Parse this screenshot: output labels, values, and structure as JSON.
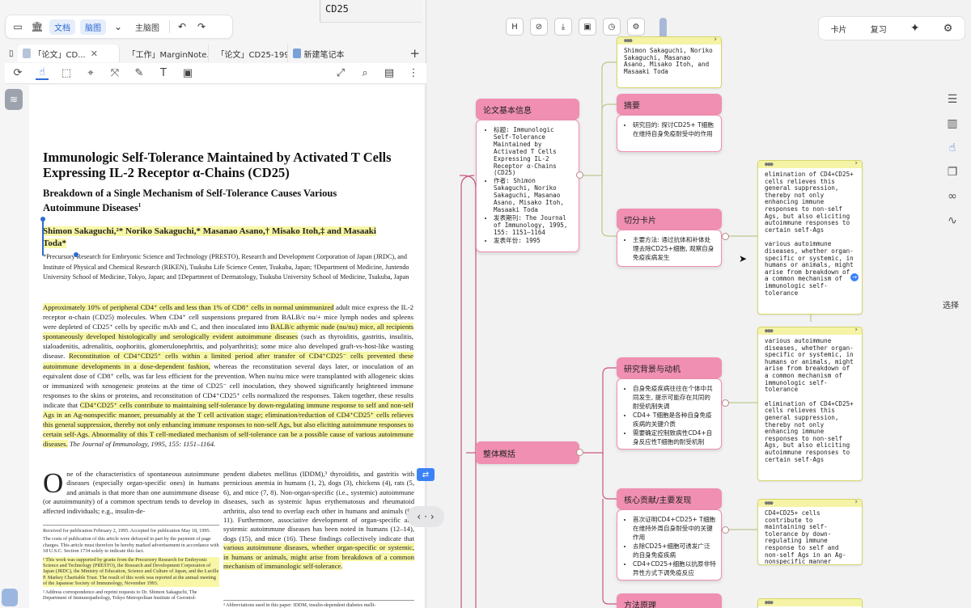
{
  "toolbar": {
    "doc_label": "文档",
    "map_label": "脑图",
    "mainmap_label": "主脑图"
  },
  "tabs": [
    {
      "label": "「论文」CD..."
    },
    {
      "label": "「工作」MarginNote..."
    },
    {
      "label": "「论文」CD25-1995..."
    },
    {
      "label": "新建笔记本"
    }
  ],
  "snippet": {
    "text": "CD25"
  },
  "paper": {
    "title": "Immunologic Self-Tolerance Maintained by Activated T Cells Expressing IL-2 Receptor α-Chains (CD25)",
    "subtitle": "Breakdown of a Single Mechanism of Self-Tolerance Causes Various Autoimmune Diseases",
    "authors": "Shimon Sakaguchi,²* Noriko Sakaguchi,* Masanao Asano,† Misako Itoh,‡ and Masaaki Toda*",
    "affil": "*Precursory Research for Embryonic Science and Technology (PRESTO), Research and Development Corporation of Japan (JRDC), and Institute of Physical and Chemical Research (RIKEN), Tsukuba Life Science Center, Tsukuba, Japan; †Department of Medicine, Juntendo University School of Medicine, Tokyo, Japan; and ‡Department of Dermatology, Tsukuba University School of Medicine, Tsukuba, Japan",
    "abstract_1": "Approximately 10% of peripheral CD4⁺ cells and less than 1% of CD8⁺ cells in normal unimmunized",
    "abstract_2": " adult mice express the IL-2 receptor α-chain (CD25) molecules. When CD4⁺ cell suspensions prepared from BALB/c nu/+ mice lymph nodes and spleens were depleted of CD25⁺ cells by specific mAb and C, and then inoculated into ",
    "abstract_3": "BALB/c athymic nude (nu/nu) mice, all recipients spontaneously developed histologically and serologically evident autoimmune diseases",
    "abstract_4": " (such as thyroiditis, gastritis, insulitis, sialoadenitis, adrenalitis, oophoritis, glomerulonephritis, and polyarthritis); some mice also developed graft-vs-host-like wasting disease. ",
    "abstract_5": "Reconstitution of CD4⁺CD25⁺ cells within a limited period after transfer of CD4⁺CD25⁻ cells prevented these autoimmune developments in a dose-dependent fashion,",
    "abstract_6": " whereas the reconstitution several days later, or inoculation of an equivalent dose of CD8⁺ cells, was far less efficient for the prevention. When nu/nu mice were transplanted with allogeneic skins or immunized with xenogeneic proteins at the time of CD25⁻ cell inoculation, they showed significantly heightened immune responses to the skins or proteins, and reconstitution of CD4⁺CD25⁺ cells normalized the responses. Taken together, these results indicate that ",
    "abstract_7": "CD4⁺CD25⁺ cells contribute to maintaining self-tolerance by down-regulating immune response to self and non-self Ags in an Ag-nonspecific manner, presumably at the T cell activation stage; elimination/reduction of CD4⁺CD25⁺ cells relieves this general suppression, thereby not only enhancing immune responses to non-self Ags, but also eliciting autoimmune responses to certain self-Ags. Abnormality of this T cell-mediated mechanism of self-tolerance can be a possible cause of various autoimmune diseases.",
    "abstract_8": " The Journal of Immunology, 1995, 155: 1151–1164.",
    "intro_dropcap": "O",
    "intro_left": "ne of the characteristics of spontaneous autoimmune diseases (especially organ-specific ones) in humans and animals is that more than one autoimmune disease (or autoimmunity) of a common spectrum tends to develop in affected individuals; e.g., insulin-de-",
    "intro_right_1": "pendent diabetes mellitus (IDDM),³ thyroiditis, and gastritis with pernicious anemia in humans (1, 2), dogs (3), chickens (4), rats (5, 6), and mice (7, 8). Non-organ-specific (i.e., systemic) autoimmune diseases, such as systemic lupus erythematosus and rheumatoid arthritis, also tend to overlap each other in humans and animals (9–11). Furthermore, associative development of organ-specific and systemic autoimmune diseases has been noted in humans (12–14), dogs (15), and mice (16). These findings collectively indicate that ",
    "intro_right_2": "various autoimmune diseases, whether organ-specific or systemic, in humans or animals, might arise from breakdown of a common mechanism of immunologic self-tolerance.",
    "fn_1": "Received for publication February 2, 1995. Accepted for publication May 18, 1995.",
    "fn_2": "The costs of publication of this article were defrayed in part by the payment of page charges. This article must therefore be hereby marked advertisement in accordance with 18 U.S.C. Section 1734 solely to indicate this fact.",
    "fn_3": "¹ This work was supported by grants from the Precursory Research for Embryonic Science and Technology (PRESTO), the Research and Development Corporation of Japan (JRDC), the Ministry of Education, Science and Culture of Japan, and the Lucille P. Markey Charitable Trust. The result of this work was reported at the annual meeting of the Japanese Society of Immunology, November 1993.",
    "fn_4": "² Address correspondence and reprint requests to Dr. Shimon Sakaguchi, The Department of Immunopathology, Tokyo Metropolitan Institute of Gerontol-",
    "fn_right": "³ Abbreviations used in this paper: IDDM, insulin-dependent diabetes melli-"
  },
  "right_toolbar": {
    "card_label": "卡片",
    "review_label": "复习"
  },
  "select_label": "选择",
  "mindmap": {
    "basic_info": {
      "title": "论文基本信息",
      "items": [
        "标题: Immunologic Self-Tolerance Maintained by Activated T Cells Expressing IL-2 Receptor α-Chains (CD25)",
        "作者: Shimon Sakaguchi, Noriko Sakaguchi, Masanao Asano, Misako Itoh, Masaaki Toda",
        "发表期刊: The Journal of Immunology, 1995, 155: 1151–1164",
        "发表年份: 1995"
      ]
    },
    "authors_card": "Shimon Sakaguchi, Noriko Sakaguchi, Masanao Asano, Misako Itoh, and Masaaki Toda",
    "summary": {
      "title": "摘要",
      "items": [
        "研究目的: 探讨CD25+ T细胞在维持自身免疫耐受中的作用"
      ]
    },
    "cut_card": {
      "title": "切分卡片",
      "items": [
        "主要方法: 通过抗体和补体处理去除CD25+细胞, 观察自身免疫疾病发生"
      ]
    },
    "cut_note": {
      "p1": "elimination of CD4+CD25+ cells relieves this general suppression, thereby not only enhancing immune responses to non-self Ags, but also eliciting autoimmune responses to certain self-Ags",
      "p2": "various autoimmune diseases, whether organ-specific or systemic, in humans or animals, might arise from breakdown of a common mechanism of immunologic self-tolerance"
    },
    "overview": {
      "title": "整体概括"
    },
    "background": {
      "title": "研究背景与动机",
      "items": [
        "自身免疫疾病往往在个体中共同发生, 提示可能存在共同的耐受机制失调",
        "CD4+ T细胞是各种自身免疫疾病的关键介质",
        "需要确定控制致病性CD4+自身反应性T细胞的耐受机制"
      ]
    },
    "bg_note": {
      "p1": "various autoimmune diseases, whether organ-specific or systemic, in humans or animals, might arise from breakdown of a common mechanism of immunologic self-tolerance",
      "p2": "elimination of CD4+CD25+ cells relieves this general suppression, thereby not only enhancing immune responses to non-self Ags, but also eliciting autoimmune responses to certain self-Ags"
    },
    "contrib": {
      "title": "核心贡献/主要发现",
      "items": [
        "首次证明CD4+CD25+ T细胞在维持外周自身耐受中的关键作用",
        "去除CD25+细胞可诱发广泛的自身免疫疾病",
        "CD4+CD25+细胞以抗原非特异性方式下调免疫反应"
      ]
    },
    "contrib_note": "CD4+CD25+ cells contribute to maintaining self-tolerance by down-regulating immune response to self and non-self Ags in an Ag-nonspecific manner",
    "method": {
      "title": "方法原理"
    }
  },
  "colors": {
    "node": "#f08fb1",
    "highlight": "#f8f7a6",
    "accent": "#2f6bd6",
    "line_left": "#c8587a",
    "line_right": "#b9c98a"
  }
}
